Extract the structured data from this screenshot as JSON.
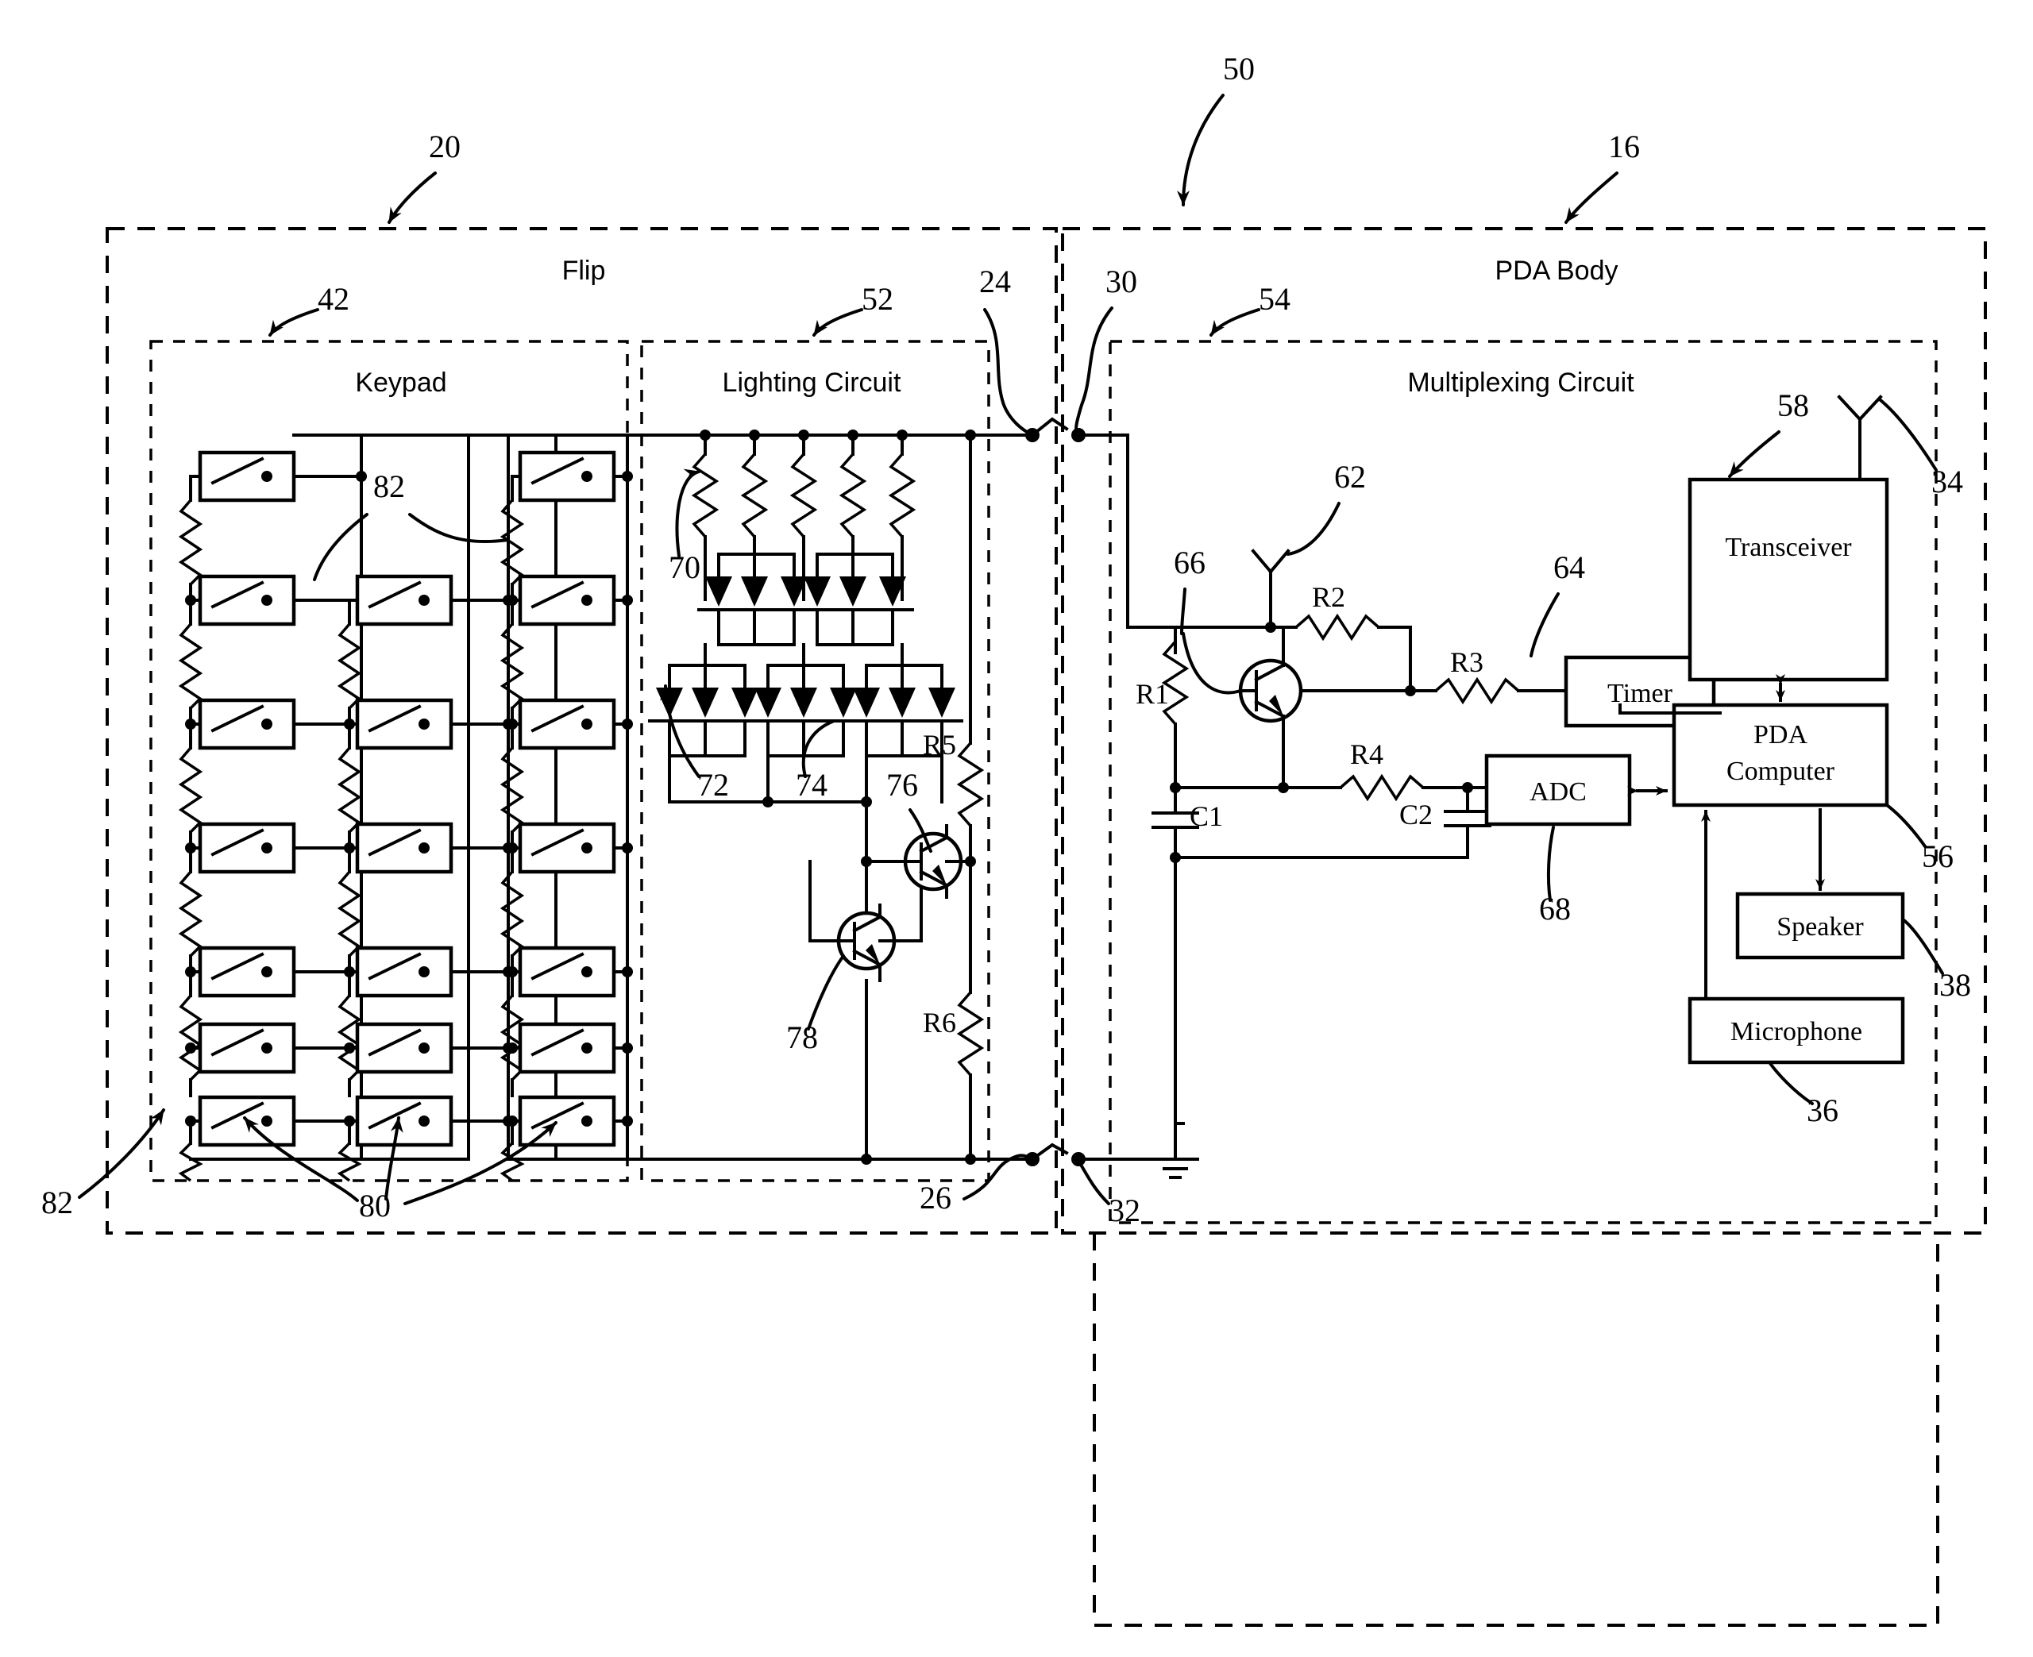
{
  "figure": {
    "type": "patent-circuit-schematic",
    "title": "PDA flip keypad lighting and multiplexing circuit schematic"
  },
  "enclosures": [
    {
      "id": "flip",
      "label": "Flip",
      "ref": "20"
    },
    {
      "id": "pda_body",
      "label": "PDA Body",
      "ref": "16"
    },
    {
      "id": "keypad",
      "label": "Keypad",
      "ref": "42"
    },
    {
      "id": "lighting_circuit",
      "label": "Lighting Circuit",
      "ref": "52"
    },
    {
      "id": "multiplexing_circuit",
      "label": "Multiplexing Circuit",
      "ref": "54"
    }
  ],
  "blocks": [
    {
      "id": "timer",
      "label": "Timer",
      "ref": "64"
    },
    {
      "id": "adc",
      "label": "ADC",
      "ref": "68"
    },
    {
      "id": "transceiver",
      "label": "Transceiver",
      "ref": "58"
    },
    {
      "id": "pda_computer",
      "label": "PDA Computer",
      "ref": "56"
    },
    {
      "id": "speaker",
      "label": "Speaker",
      "ref": "38"
    },
    {
      "id": "microphone",
      "label": "Microphone",
      "ref": "36"
    }
  ],
  "components": [
    {
      "id": "r1",
      "label": "R1",
      "kind": "resistor"
    },
    {
      "id": "r2",
      "label": "R2",
      "kind": "resistor"
    },
    {
      "id": "r3",
      "label": "R3",
      "kind": "resistor"
    },
    {
      "id": "r4",
      "label": "R4",
      "kind": "resistor"
    },
    {
      "id": "r5",
      "label": "R5",
      "kind": "resistor"
    },
    {
      "id": "r6",
      "label": "R6",
      "kind": "resistor"
    },
    {
      "id": "c1",
      "label": "C1",
      "kind": "capacitor"
    },
    {
      "id": "c2",
      "label": "C2",
      "kind": "capacitor"
    },
    {
      "id": "q66",
      "label": "66",
      "kind": "transistor"
    },
    {
      "id": "q76",
      "label": "76",
      "kind": "transistor"
    },
    {
      "id": "q78",
      "label": "78",
      "kind": "transistor"
    }
  ],
  "reference_numerals": [
    {
      "num": "50",
      "points_to": "overall-system"
    },
    {
      "num": "20",
      "points_to": "flip-enclosure"
    },
    {
      "num": "16",
      "points_to": "pda-body-enclosure"
    },
    {
      "num": "42",
      "points_to": "keypad-enclosure"
    },
    {
      "num": "52",
      "points_to": "lighting-circuit-enclosure"
    },
    {
      "num": "54",
      "points_to": "multiplexing-circuit-enclosure"
    },
    {
      "num": "24",
      "points_to": "flip-upper-contact"
    },
    {
      "num": "30",
      "points_to": "body-upper-contact"
    },
    {
      "num": "26",
      "points_to": "flip-lower-contact"
    },
    {
      "num": "32",
      "points_to": "body-lower-contact"
    },
    {
      "num": "34",
      "points_to": "antenna"
    },
    {
      "num": "36",
      "points_to": "microphone-block"
    },
    {
      "num": "38",
      "points_to": "speaker-block"
    },
    {
      "num": "56",
      "points_to": "pda-computer-block"
    },
    {
      "num": "58",
      "points_to": "transceiver-block"
    },
    {
      "num": "62",
      "points_to": "supply-node"
    },
    {
      "num": "64",
      "points_to": "timer-block"
    },
    {
      "num": "66",
      "points_to": "multiplexer-transistor"
    },
    {
      "num": "68",
      "points_to": "adc-block"
    },
    {
      "num": "70",
      "points_to": "lighting-resistor"
    },
    {
      "num": "72",
      "points_to": "led-bank"
    },
    {
      "num": "74",
      "points_to": "led-element"
    },
    {
      "num": "76",
      "points_to": "upper-lighting-transistor"
    },
    {
      "num": "78",
      "points_to": "lower-lighting-transistor"
    },
    {
      "num": "80",
      "points_to": "keypad-switch"
    },
    {
      "num": "82",
      "points_to": "keypad-resistor"
    }
  ],
  "keypad": {
    "columns": 3,
    "rows": 7,
    "switch_ref": "80",
    "resistor_ref": "82"
  },
  "lighting": {
    "resistor_count": 5,
    "led_bank_count": 6,
    "leds_per_bank": 3,
    "resistor_ref": "70",
    "bank_ref": "72",
    "led_ref": "74"
  },
  "colors": {
    "ink": "#000000",
    "paper": "#ffffff"
  }
}
